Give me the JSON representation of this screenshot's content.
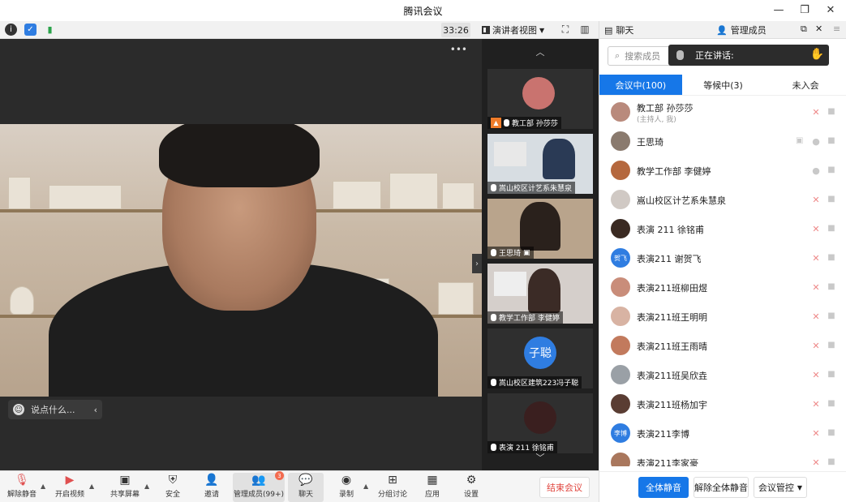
{
  "window": {
    "title": "腾讯会议"
  },
  "toolbar": {
    "timer": "33:26",
    "view_label": "演讲者视图"
  },
  "main_video": {
    "chat_placeholder": "说点什么..."
  },
  "thumbnails": [
    {
      "name": "教工部 孙莎莎",
      "avatar_color": "#cc8888"
    },
    {
      "name": "嵩山校区计艺系朱慧泉"
    },
    {
      "name": "王思琦"
    },
    {
      "name": "教学工作部 李健婷"
    },
    {
      "name": "嵩山校区建筑223冯子聪",
      "avatar_text": "子聪",
      "avatar_color": "#2f7de1"
    },
    {
      "name": "表演 211 徐铭甫"
    }
  ],
  "controls": {
    "unmute": "解除静音",
    "video": "开启视频",
    "share": "共享屏幕",
    "security": "安全",
    "invite": "邀请",
    "members": "管理成员(99+)",
    "members_badge": "3",
    "chat": "聊天",
    "record": "录制",
    "breakout": "分组讨论",
    "apps": "应用",
    "settings": "设置",
    "end": "结束会议"
  },
  "panel": {
    "tab_chat": "聊天",
    "tab_members": "管理成员",
    "search_placeholder": "搜索成员",
    "speaking_label": "正在讲话:",
    "segments": {
      "in_meeting": "会议中(100)",
      "waiting": "等候中(3)",
      "not_joined": "未入会"
    },
    "members": [
      {
        "name": "教工部 孙莎莎",
        "sub": "(主持人, 我)",
        "avatar_color": "#b98a7c",
        "muted": true
      },
      {
        "name": "王思琦",
        "avatar_color": "#8a7a6e",
        "muted": false,
        "sharing": true
      },
      {
        "name": "教学工作部 李健婷",
        "avatar_color": "#b5683e",
        "muted": false
      },
      {
        "name": "嵩山校区计艺系朱慧泉",
        "avatar_color": "#d0c9c4",
        "muted": true
      },
      {
        "name": "表演 211 徐铭甫",
        "avatar_color": "#3a2a22",
        "muted": true
      },
      {
        "name": "表演211 谢贺飞",
        "avatar_text": "贺飞",
        "avatar_color": "#2f7de1",
        "muted": true
      },
      {
        "name": "表演211班柳田煜",
        "avatar_color": "#c98d7a",
        "muted": true
      },
      {
        "name": "表演211班王明明",
        "avatar_color": "#d8b3a3",
        "muted": true
      },
      {
        "name": "表演211班王雨晴",
        "avatar_color": "#c27a5d",
        "muted": true
      },
      {
        "name": "表演211班吴欣垚",
        "avatar_color": "#9aa0a6",
        "muted": true
      },
      {
        "name": "表演211班杨加宇",
        "avatar_color": "#5a3d33",
        "muted": true
      },
      {
        "name": "表演211李博",
        "avatar_text": "李博",
        "avatar_color": "#2f7de1",
        "muted": true
      },
      {
        "name": "表演211李家豪",
        "avatar_color": "#a9775d",
        "muted": true
      }
    ],
    "mute_all": "全体静音",
    "unmute_all": "解除全体静音",
    "meeting_control": "会议管控"
  }
}
